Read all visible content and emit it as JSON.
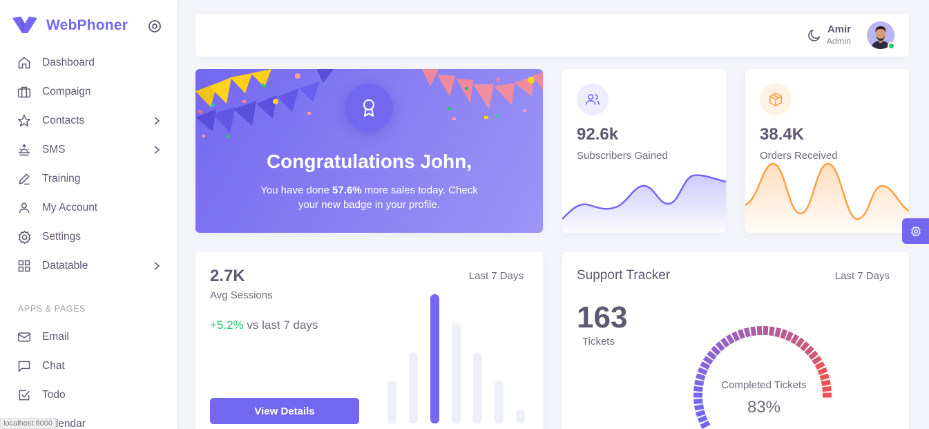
{
  "brand": {
    "name": "WebPhoner",
    "color": "#7367f0"
  },
  "sidebar": {
    "items": [
      {
        "label": "Dashboard",
        "icon": "home-icon"
      },
      {
        "label": "Compaign",
        "icon": "briefcase-icon"
      },
      {
        "label": "Contacts",
        "icon": "star-icon",
        "has_submenu": true
      },
      {
        "label": "SMS",
        "icon": "sunrise-icon",
        "has_submenu": true
      },
      {
        "label": "Training",
        "icon": "edit-icon"
      },
      {
        "label": "My Account",
        "icon": "user-icon"
      },
      {
        "label": "Settings",
        "icon": "settings-icon"
      },
      {
        "label": "Datatable",
        "icon": "grid-icon",
        "has_submenu": true
      }
    ],
    "section_title": "APPS & PAGES",
    "apps": [
      {
        "label": "Email",
        "icon": "mail-icon"
      },
      {
        "label": "Chat",
        "icon": "message-square-icon"
      },
      {
        "label": "Todo",
        "icon": "check-square-icon"
      },
      {
        "label": "Calendar",
        "icon": "calendar-icon"
      }
    ],
    "status_url": "localhost:8000"
  },
  "header": {
    "theme_icon": "moon-icon",
    "user_name": "Amir",
    "user_role": "Admin",
    "status_color": "#28c76f"
  },
  "congrats": {
    "title": "Congratulations John,",
    "text_before": "You have done ",
    "highlight": "57.6%",
    "text_after": " more sales today. Check your new badge in your profile.",
    "icon": "award-icon"
  },
  "stats": [
    {
      "value": "92.6k",
      "label": "Subscribers Gained",
      "icon": "users-icon",
      "color": "#7367f0"
    },
    {
      "value": "38.4K",
      "label": "Orders Received",
      "icon": "package-icon",
      "color": "#ff9f43"
    }
  ],
  "sessions": {
    "value": "2.7K",
    "label": "Avg Sessions",
    "period": "Last 7 Days",
    "growth": "+5.2%",
    "growth_suffix": " vs last 7 days",
    "button": "View Details",
    "bar_levels": [
      0.33,
      0.55,
      1.0,
      0.78,
      0.55,
      0.33,
      0.11
    ],
    "highlight_index": 2
  },
  "support": {
    "title": "Support Tracker",
    "period": "Last 7 Days",
    "value": "163",
    "value_label": "Tickets",
    "gauge_label": "Completed Tickets",
    "gauge_value": "83%",
    "gauge_fraction": 0.83
  }
}
